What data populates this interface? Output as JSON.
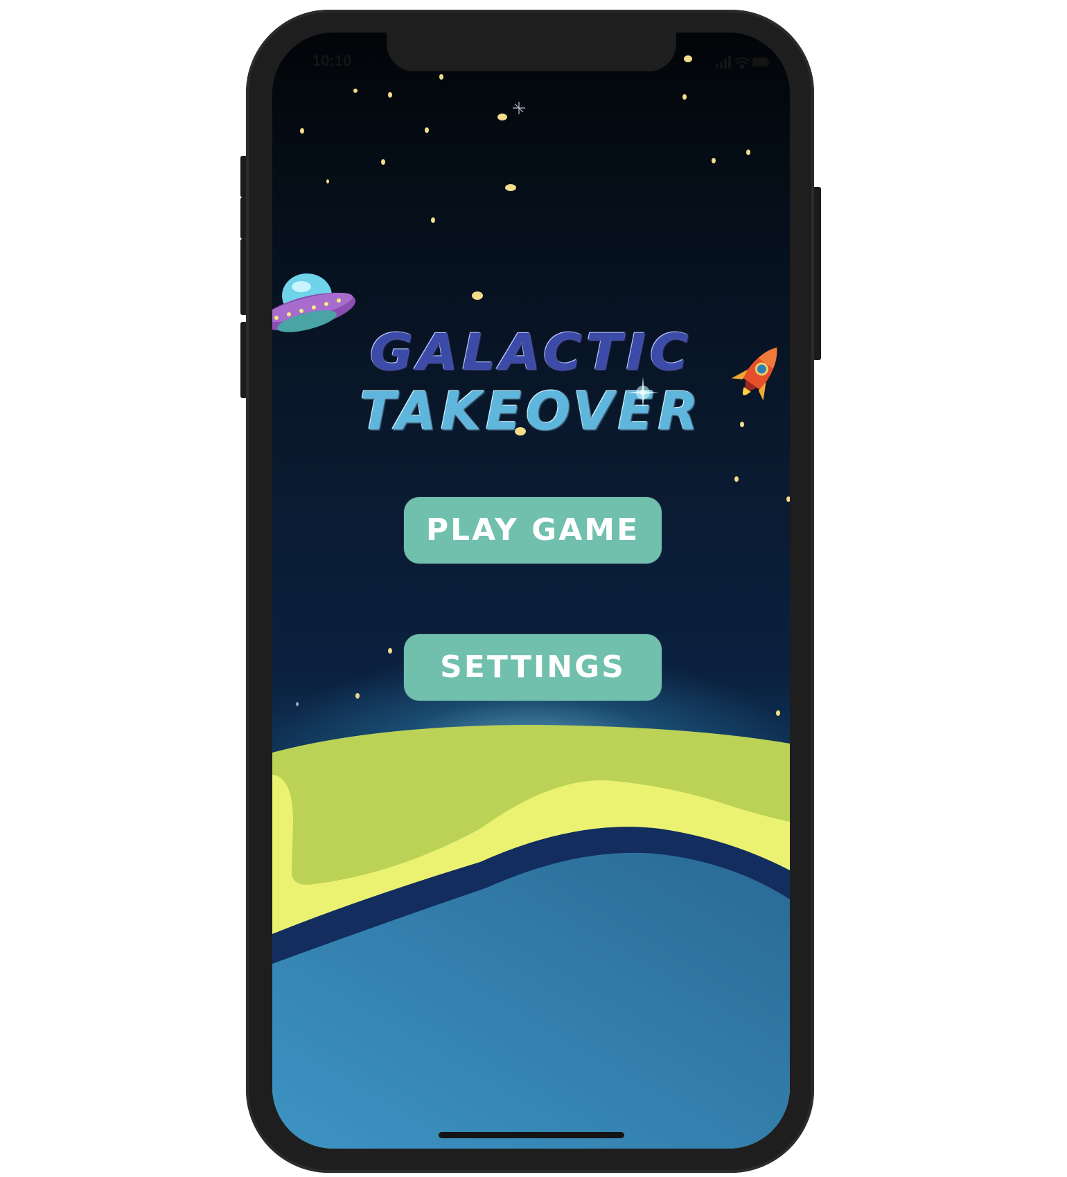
{
  "status_bar": {
    "time": "10:10",
    "signal_icon": "cellular-signal-icon",
    "wifi_icon": "wifi-icon",
    "battery_icon": "battery-icon"
  },
  "title": {
    "line1": "GALACTIC",
    "line2": "TAKEOVER"
  },
  "menu": {
    "play_label": "PLAY GAME",
    "settings_label": "SETTINGS"
  },
  "decorations": {
    "ufo_icon": "ufo-icon",
    "rocket_icon": "rocket-icon",
    "star_icon": "star-icon"
  },
  "colors": {
    "button": "#71c0ad",
    "sky_top": "#020508",
    "planet_green": "#bbd257",
    "planet_yellow": "#ebf272",
    "planet_blue": "#3a8dbd"
  }
}
